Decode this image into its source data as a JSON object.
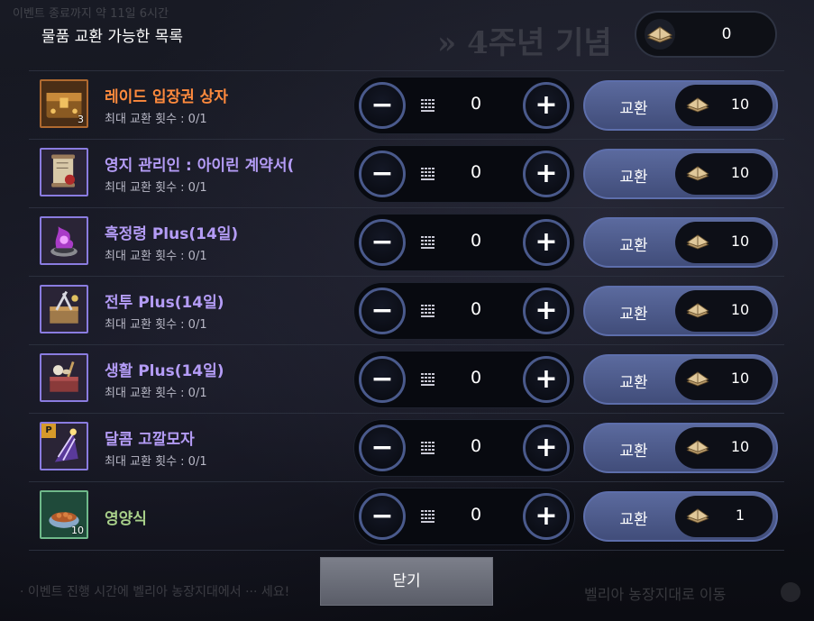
{
  "background": {
    "top_left_text": "이벤트 종료까지 약 11일 6시간",
    "banner_text": "» 4주년 기념",
    "footer_left": "· 이벤트 진행 시간에 벨리아 농장지대에서 ··· 세요!",
    "footer_right": "벨리아 농장지대로 이동"
  },
  "dialog": {
    "title": "물품 교환 가능한 목록",
    "currency": {
      "icon": "book-token-icon",
      "amount": "0"
    },
    "exchange_label": "교환",
    "close_label": "닫기",
    "items": [
      {
        "name": "레이드 입장권 상자",
        "limit": "최대 교환 횟수 : 0/1",
        "qty": "3",
        "quantity": "0",
        "cost": "10",
        "color": "#ff8a3d",
        "icon": "raid-chest-icon"
      },
      {
        "name": "영지 관리인 : 아이린 계약서(",
        "limit": "최대 교환 횟수 : 0/1",
        "qty": "",
        "quantity": "0",
        "cost": "10",
        "color": "#b49cf6",
        "icon": "contract-scroll-icon"
      },
      {
        "name": "흑정령 Plus(14일)",
        "limit": "최대 교환 횟수 : 0/1",
        "qty": "",
        "quantity": "0",
        "cost": "10",
        "color": "#b49cf6",
        "icon": "black-spirit-icon"
      },
      {
        "name": "전투 Plus(14일)",
        "limit": "최대 교환 횟수 : 0/1",
        "qty": "",
        "quantity": "0",
        "cost": "10",
        "color": "#b49cf6",
        "icon": "combat-box-icon"
      },
      {
        "name": "생활 Plus(14일)",
        "limit": "최대 교환 횟수 : 0/1",
        "qty": "",
        "quantity": "0",
        "cost": "10",
        "color": "#b49cf6",
        "icon": "life-box-icon"
      },
      {
        "name": "달콤 고깔모자",
        "limit": "최대 교환 횟수 : 0/1",
        "qty": "",
        "quantity": "0",
        "cost": "10",
        "color": "#b49cf6",
        "icon": "party-hat-icon"
      },
      {
        "name": "영양식",
        "limit": "",
        "qty": "10",
        "quantity": "0",
        "cost": "1",
        "color": "#a8d08a",
        "icon": "pet-food-icon"
      }
    ]
  }
}
